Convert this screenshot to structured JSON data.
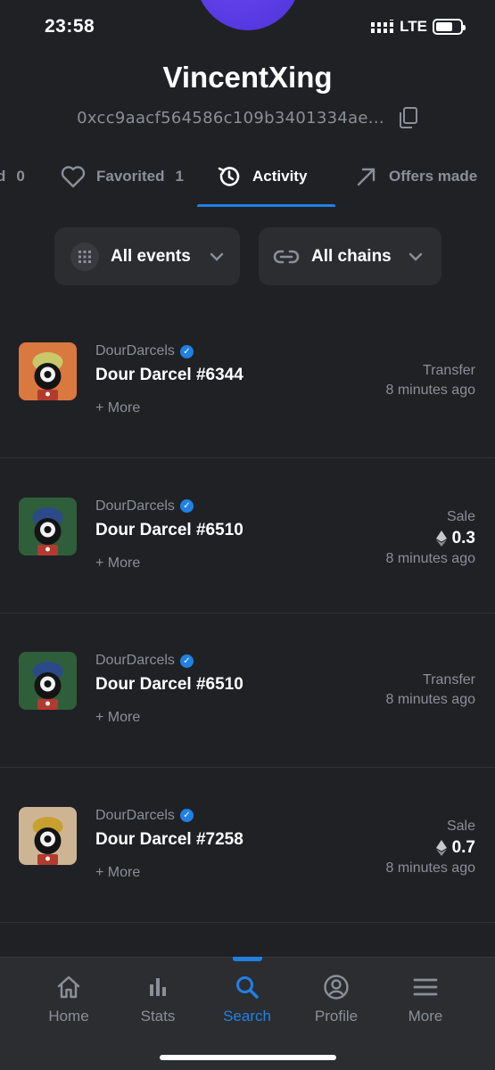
{
  "status": {
    "time": "23:58",
    "network": "LTE"
  },
  "profile": {
    "username": "VincentXing",
    "address": "0xcc9aacf564586c109b3401334ae..."
  },
  "tabs": [
    {
      "label": "d",
      "count": "0"
    },
    {
      "label": "Favorited",
      "count": "1"
    },
    {
      "label": "Activity",
      "count": ""
    },
    {
      "label": "Offers made",
      "count": ""
    }
  ],
  "filters": {
    "events": "All events",
    "chains": "All chains"
  },
  "activity": [
    {
      "collection": "DourDarcels",
      "name": "Dour Darcel #6344",
      "more": "+ More",
      "event": "Transfer",
      "price": "",
      "time": "8 minutes ago",
      "thumb_bg": "#d9783f",
      "hat_color": "#c8c86a"
    },
    {
      "collection": "DourDarcels",
      "name": "Dour Darcel #6510",
      "more": "+ More",
      "event": "Sale",
      "price": "0.3",
      "time": "8 minutes ago",
      "thumb_bg": "#2f5e3a",
      "hat_color": "#2c4a8a"
    },
    {
      "collection": "DourDarcels",
      "name": "Dour Darcel #6510",
      "more": "+ More",
      "event": "Transfer",
      "price": "",
      "time": "8 minutes ago",
      "thumb_bg": "#2f5e3a",
      "hat_color": "#2c4a8a"
    },
    {
      "collection": "DourDarcels",
      "name": "Dour Darcel #7258",
      "more": "+ More",
      "event": "Sale",
      "price": "0.7",
      "time": "8 minutes ago",
      "thumb_bg": "#cdb594",
      "hat_color": "#c8a030"
    }
  ],
  "nav": [
    {
      "label": "Home",
      "icon": "home-icon"
    },
    {
      "label": "Stats",
      "icon": "stats-icon"
    },
    {
      "label": "Search",
      "icon": "search-icon"
    },
    {
      "label": "Profile",
      "icon": "profile-icon"
    },
    {
      "label": "More",
      "icon": "menu-icon"
    }
  ],
  "colors": {
    "accent": "#2081e2",
    "background": "#202125",
    "surface": "#2b2d31",
    "muted": "#8a8f98"
  }
}
